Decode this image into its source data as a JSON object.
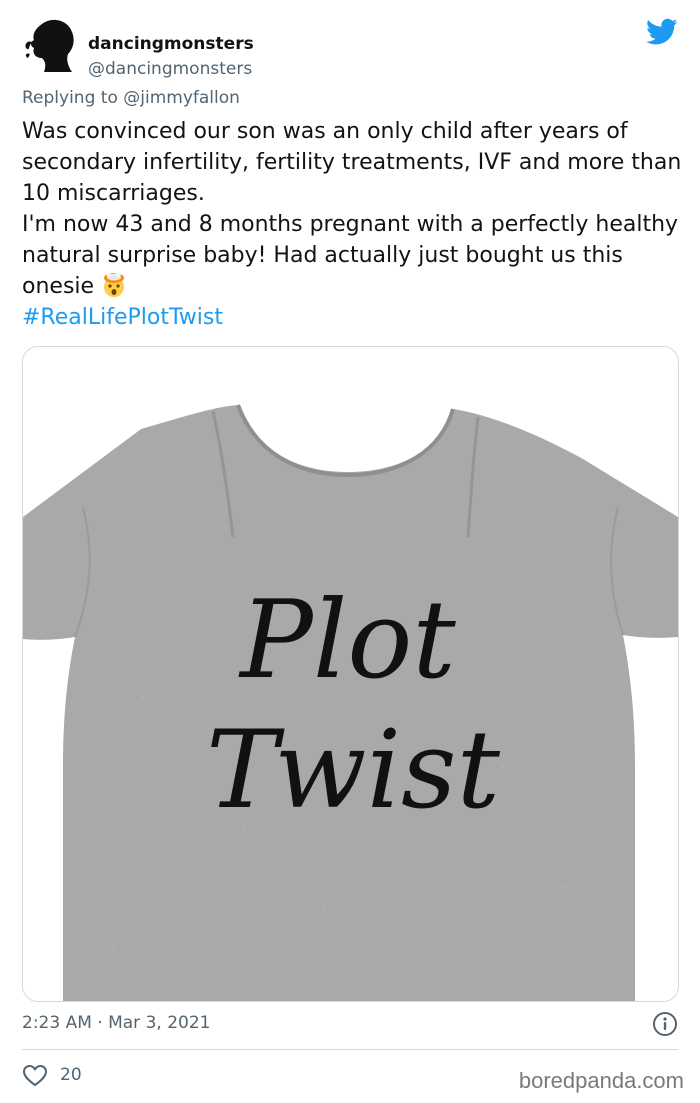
{
  "tweet": {
    "author": {
      "display_name": "dancingmonsters",
      "handle": "@dancingmonsters",
      "avatar_icon": "silhouette-avatar-icon"
    },
    "reply": {
      "prefix": "Replying to ",
      "mention": "@jimmyfallon"
    },
    "text": {
      "paragraph_1": "Was convinced our son was an only child after years of secondary infertility, fertility treatments, IVF and more than 10 miscarriages.",
      "paragraph_2": "I'm now 43 and 8 months pregnant with a perfectly healthy natural surprise baby!  Had actually just bought us this onesie",
      "emoji": "exploding-head-emoji",
      "hashtag": "#RealLifePlotTwist"
    },
    "media": {
      "onesie_text_line_1": "Plot",
      "onesie_text_line_2": "Twist",
      "onesie_color": "#a9a9a9"
    },
    "timestamp": "2:23 AM · Mar 3, 2021",
    "likes": "20"
  },
  "colors": {
    "accent": "#1d9bf0",
    "secondary_text": "#536471",
    "border": "#cfd9de"
  },
  "watermark": "boredpanda.com"
}
